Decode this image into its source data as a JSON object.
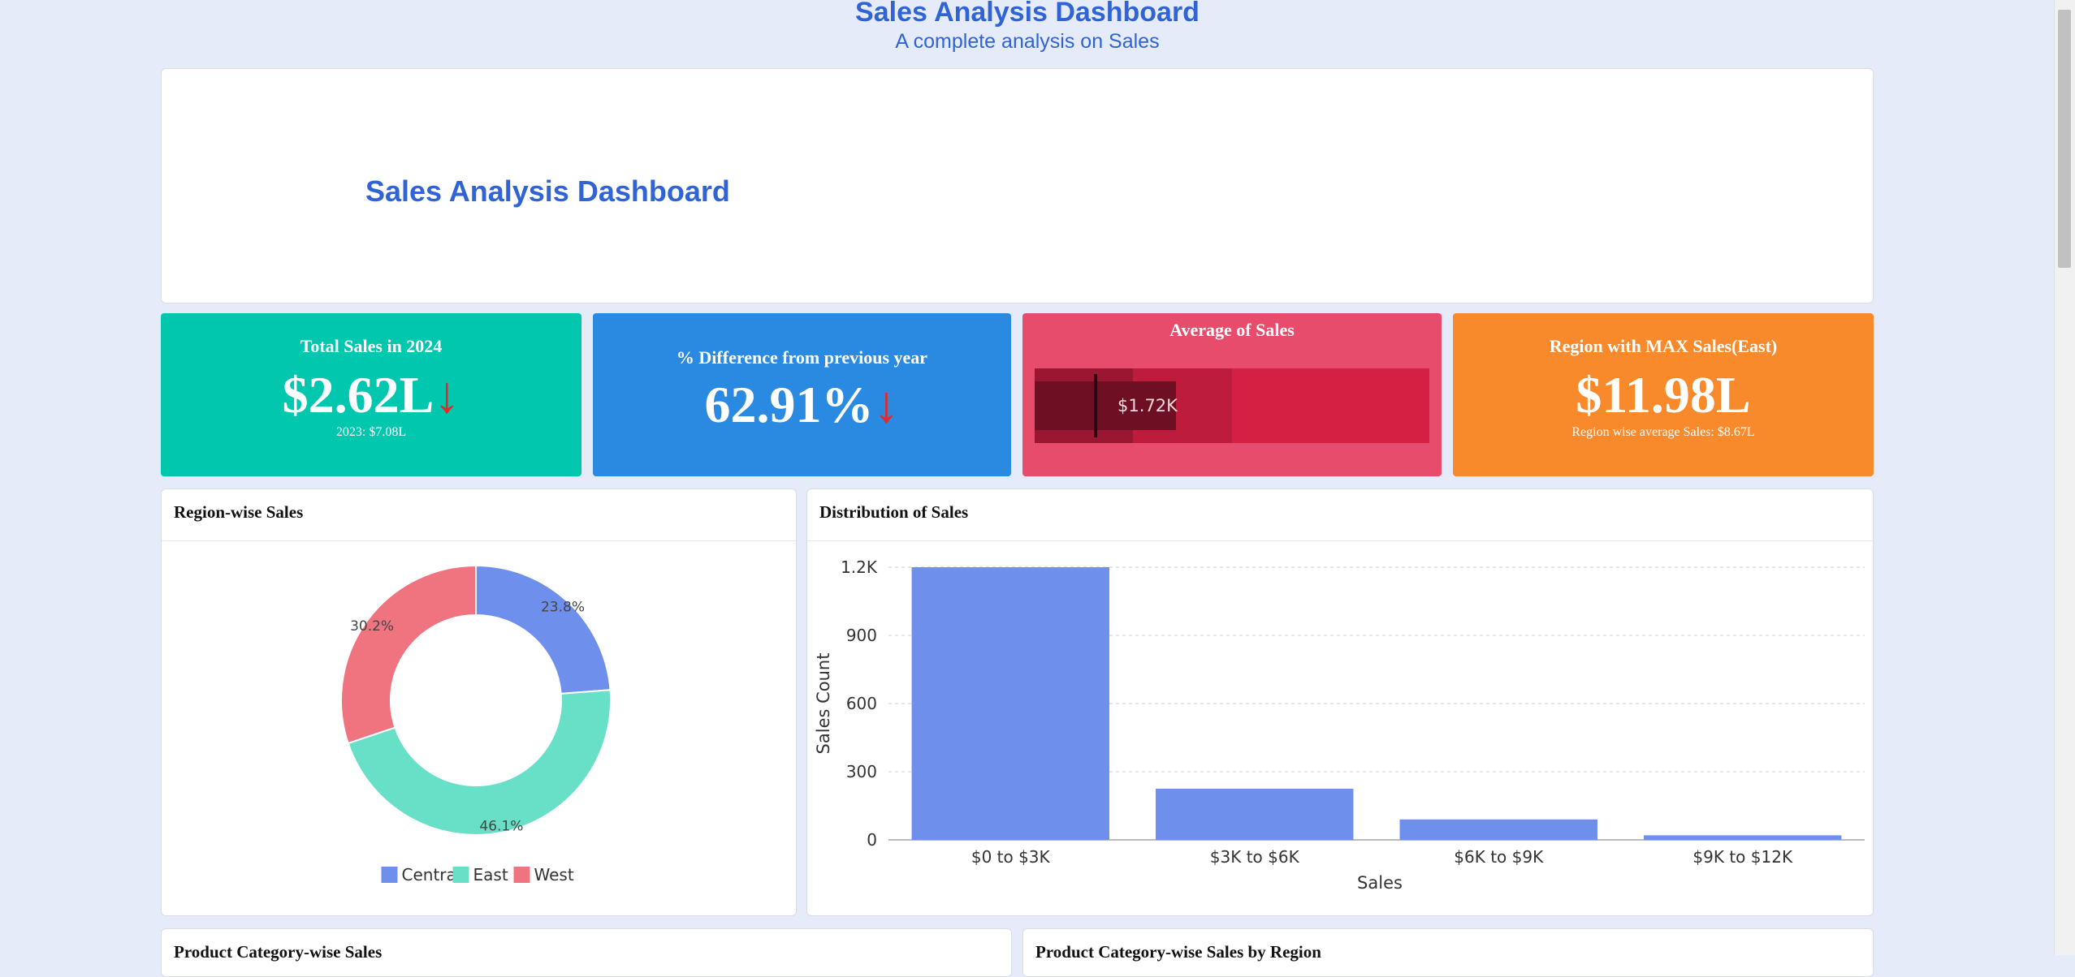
{
  "header": {
    "title": "Sales Analysis Dashboard",
    "subtitle": "A complete analysis on Sales"
  },
  "banner": {
    "title": "Sales Analysis Dashboard"
  },
  "kpis": {
    "total_sales": {
      "title": "Total Sales in 2024",
      "value": "$2.62L",
      "arrow": "↓",
      "sub": "2023: $7.08L",
      "color": "#00c7ad"
    },
    "pct_diff": {
      "title": "% Difference from previous year",
      "value": "62.91%",
      "arrow": "↓",
      "color": "#2a89e0"
    },
    "avg_sales": {
      "title": "Average of Sales",
      "value": "$1.72K",
      "color": "#e84c6c"
    },
    "max_region": {
      "title": "Region with MAX Sales(East)",
      "value": "$11.98L",
      "sub": "Region wise average Sales: $8.67L",
      "color": "#f88a2c"
    }
  },
  "region_card": {
    "title": "Region-wise Sales"
  },
  "distribution_card": {
    "title": "Distribution of Sales"
  },
  "bottom_cards": {
    "left_title": "Product Category-wise Sales",
    "right_title": "Product Category-wise Sales by Region"
  },
  "chart_data": [
    {
      "type": "pie",
      "title": "Region-wise Sales",
      "categories": [
        "Central",
        "East",
        "West"
      ],
      "values": [
        23.8,
        46.1,
        30.2
      ],
      "labels": [
        "23.8%",
        "46.1%",
        "30.2%"
      ],
      "colors": [
        "#6e8fec",
        "#67e0c7",
        "#f07480"
      ],
      "legend": "bottom"
    },
    {
      "type": "bar",
      "title": "Distribution of Sales",
      "categories": [
        "$0 to $3K",
        "$3K to $6K",
        "$6K to $9K",
        "$9K to $12K"
      ],
      "values": [
        1200,
        225,
        90,
        20
      ],
      "xlabel": "Sales",
      "ylabel": "Sales Count",
      "yticks": [
        "0",
        "300",
        "600",
        "900",
        "1.2K"
      ],
      "ylim": [
        0,
        1200
      ],
      "color": "#6e8fec",
      "grid": true
    }
  ]
}
